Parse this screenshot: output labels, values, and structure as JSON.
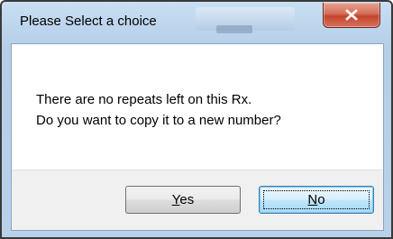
{
  "window": {
    "title": "Please Select a choice",
    "close_icon": "close-x-icon"
  },
  "message": {
    "line1": "There are no repeats left on this Rx.",
    "line2": "Do you want to copy it to a new number?"
  },
  "buttons": {
    "yes": {
      "mnemonic": "Y",
      "rest": "es"
    },
    "no": {
      "mnemonic": "N",
      "rest": "o"
    }
  },
  "colors": {
    "close_button": "#c5442c",
    "default_button_border": "#3c7fb1",
    "frame": "#b9d1ea"
  }
}
